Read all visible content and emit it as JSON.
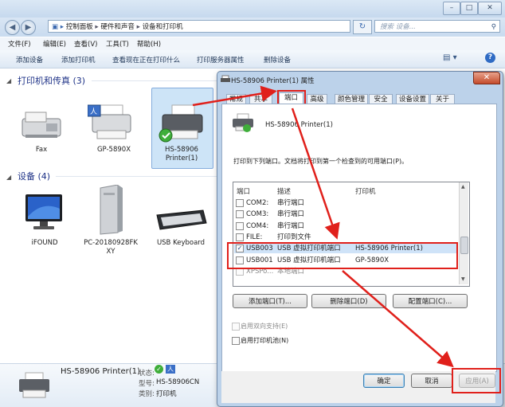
{
  "explorer": {
    "address": [
      "控制面板",
      "硬件和声音",
      "设备和打印机"
    ],
    "search_placeholder": "搜索 设备...",
    "menu": [
      "文件(F)",
      "编辑(E)",
      "查看(V)",
      "工具(T)",
      "帮助(H)"
    ],
    "commands": [
      "添加设备",
      "添加打印机",
      "查看现在正在打印什么",
      "打印服务器属性",
      "删除设备"
    ],
    "printers_section": "打印机和传真 (3)",
    "printers": [
      "Fax",
      "GP-5890X",
      "HS-58906\nPrinter(1)"
    ],
    "devices_section": "设备 (4)",
    "devices": [
      "iFOUND",
      "PC-20180928FK\nXY",
      "USB Keyboard"
    ],
    "details": {
      "name": "HS-58906 Printer(1)",
      "status_label": "状态:",
      "model_label": "型号:",
      "model": "HS-58906CN",
      "category_label": "类别:",
      "category": "打印机"
    }
  },
  "dialog": {
    "title": "HS-58906 Printer(1) 属性",
    "tabs": [
      "常规",
      "共享",
      "端口",
      "高级",
      "颜色管理",
      "安全",
      "设备设置",
      "关于"
    ],
    "printer_name": "HS-58906 Printer(1)",
    "instruction": "打印到下列端口。文档将打印到第一个检查到的可用端口(P)。",
    "columns": [
      "端口",
      "描述",
      "打印机"
    ],
    "ports": [
      {
        "port": "COM2:",
        "desc": "串行端口",
        "printer": "",
        "checked": false
      },
      {
        "port": "COM3:",
        "desc": "串行端口",
        "printer": "",
        "checked": false
      },
      {
        "port": "COM4:",
        "desc": "串行端口",
        "printer": "",
        "checked": false
      },
      {
        "port": "FILE:",
        "desc": "打印到文件",
        "printer": "",
        "checked": false
      },
      {
        "port": "USB003",
        "desc": "USB 虚拟打印机端口",
        "printer": "HS-58906 Printer(1)",
        "checked": true
      },
      {
        "port": "USB001",
        "desc": "USB 虚拟打印机端口",
        "printer": "GP-5890X",
        "checked": false
      },
      {
        "port": "XPSPo...",
        "desc": "本地端口",
        "printer": "",
        "checked": false
      }
    ],
    "add_port": "添加端口(T)...",
    "delete_port": "删除端口(D)",
    "config_port": "配置端口(C)...",
    "bidirectional": "启用双向支持(E)",
    "pooling": "启用打印机池(N)",
    "ok": "确定",
    "cancel": "取消",
    "apply": "应用(A)"
  },
  "colors": {
    "annotation": "#e0201b",
    "section_text": "#1e3287",
    "selection": "#cde4f7"
  }
}
